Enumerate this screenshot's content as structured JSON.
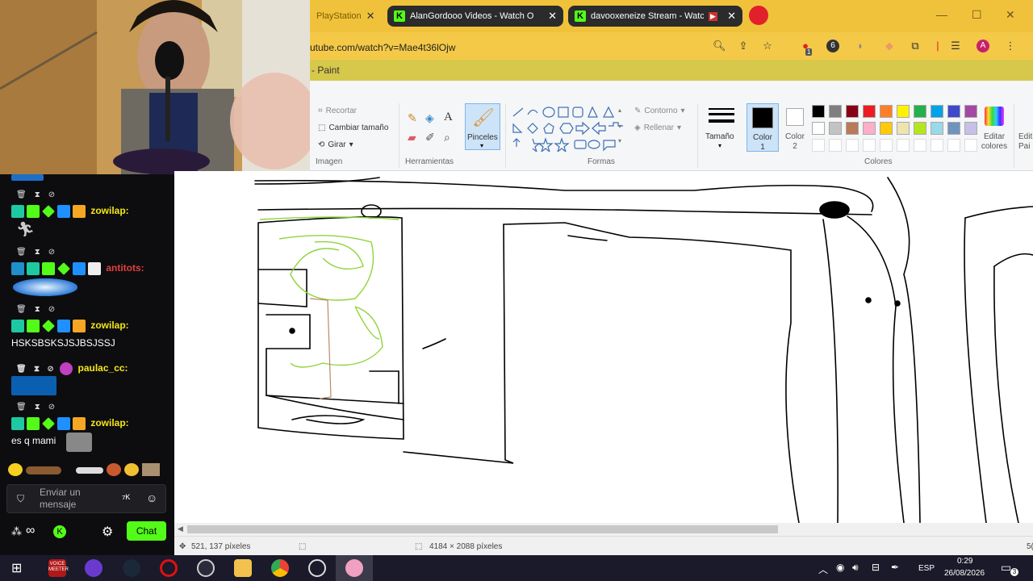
{
  "browser": {
    "tabs": [
      {
        "label": "PlayStation"
      },
      {
        "label": "AlanGordooo Videos - Watch O"
      },
      {
        "label": "davooxeneize Stream - Watc"
      }
    ],
    "url": "utube.com/watch?v=Mae4t36lOjw",
    "bookmark_text": "- Paint",
    "profile_letter": "A",
    "ext_badge_1": "1",
    "ext_badge_2": "6"
  },
  "paint": {
    "groups": {
      "imagen": "Imagen",
      "herramientas": "Herramientas",
      "formas": "Formas",
      "colores": "Colores"
    },
    "imagen_buttons": {
      "recortar": "Recortar",
      "cambiar": "Cambiar tamaño",
      "girar": "Girar"
    },
    "pinceles": "Pinceles",
    "contorno": "Contorno",
    "rellenar": "Rellenar",
    "tamano": "Tamaño",
    "color1": "Color\n1",
    "color2": "Color\n2",
    "editar_colores": "Editar colores",
    "editar_paint": "Edit Pai",
    "palette": [
      "#000000",
      "#7f7f7f",
      "#880015",
      "#ed1c24",
      "#ff7f27",
      "#fff200",
      "#22b14c",
      "#00a2e8",
      "#3f48cc",
      "#a349a4",
      "#ffffff",
      "#c3c3c3",
      "#b97a57",
      "#ffaec9",
      "#ffc90e",
      "#efe4b0",
      "#b5e61d",
      "#99d9ea",
      "#7092be",
      "#c8bfe7"
    ],
    "status": {
      "coords": "521, 137 píxeles",
      "size": "4184 × 2088 píxeles",
      "zoom_partial": "5("
    }
  },
  "chat": {
    "messages": [
      {
        "user": "zowilap:",
        "user_color": "#f5e617",
        "text": ""
      },
      {
        "user": "antitots:",
        "user_color": "#e04040",
        "text": ""
      },
      {
        "user": "zowilap:",
        "user_color": "#f5e617",
        "text": "HSKSBSKSJSJBSJSSJ"
      },
      {
        "user": "paulac_cc:",
        "user_color": "#f5e617",
        "text": ""
      },
      {
        "user": "zowilap:",
        "user_color": "#f5e617",
        "text": "es q mami"
      }
    ],
    "input_placeholder": "Enviar un\nmensaje",
    "send_label": "Chat"
  },
  "taskbar": {
    "lang": "ESP",
    "time": "0:29",
    "date": "26/08/2026",
    "notif_count": "3",
    "voicemeeter": "VOICE\nMEETER"
  }
}
